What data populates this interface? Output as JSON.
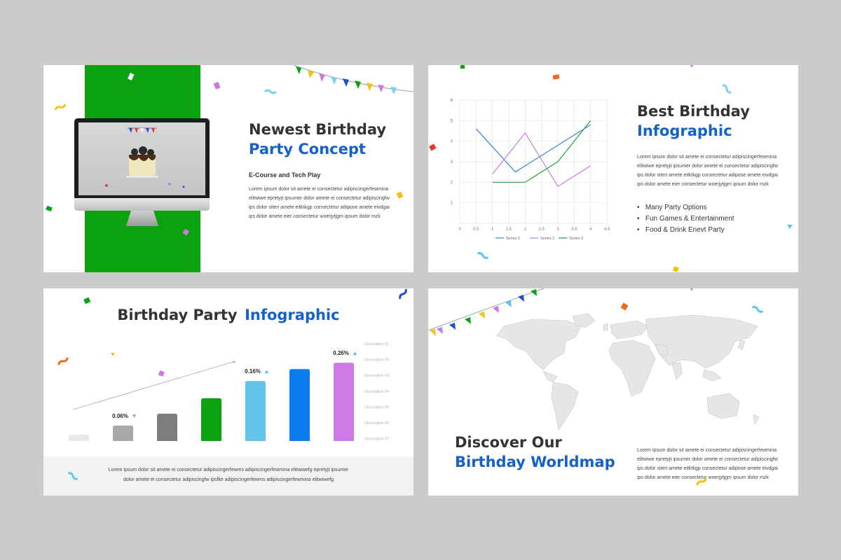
{
  "slide1": {
    "title_line1": "Newest Birthday",
    "title_line2": "Party Concept",
    "subtitle": "E-Course and Tech Play",
    "body": [
      "Lorem ipsum dolor sit amete ei consectetur adipiscingerfewmina",
      "elitwiwe epretyjt ipsumer dolor amete ei consectetur adipiscingfw",
      "ips dolor siteri amete eitktkgp consectetur adipose amete eivdgai",
      "ips dolor amete eier consectetur woerjytjgm ipsum dolor mzk"
    ]
  },
  "slide2": {
    "title_line1": "Best Birthday",
    "title_line2": "Infographic",
    "body": [
      "Lorem ipsum dolor sit amete ei consectetur adipiscingerfewmina",
      "elitwiwe epretyjt ipsumer dolor amete ei consectetur adipiscingfw",
      "ips dolor siteri amete eitktkgp consectetur adipose amete eivdgai",
      "ips dolor amete eier consectetur woerjytjgm ipsum dolor mzk"
    ],
    "bullets": [
      "Many Party Options",
      "Fun Games & Entertainment",
      "Food & Drink Enevt Party"
    ]
  },
  "slide3": {
    "title_dark": "Birthday Party",
    "title_blue": "Infographic",
    "footer": [
      "Lorem ipsum dolor sit amete ei consectetur adipiscingerfewms adipiscingerfewmina elitwiwefg epretyjt ipsumer",
      "dolor amete ei consectetur adipiscingfw ipsfke adipiscingerfewms adipiscingerfewmina elitwiwefg"
    ]
  },
  "slide4": {
    "title_line1": "Discover Our",
    "title_line2": "Birthday Worldmap",
    "body": [
      "Lorem ipsum dolor sit amete ei consectetur adipiscingerfewmina",
      "elitwiwe epretyjt ipsumer dolor amete ei consectetur adipiscingfw",
      "ips dolor siteri amete eitktkgp consectetur adipose amete eivdgai",
      "ips dolor amete eier consectetur woerjytjgm ipsum dolor mzk"
    ]
  },
  "colors": {
    "accent_blue": "#1461c9",
    "accent_green": "#0aa30f",
    "dark_text": "#333333",
    "series1": "#3a86d0",
    "series2": "#c77be0",
    "series3": "#22a33a"
  },
  "chart_data": [
    {
      "type": "line",
      "x": [
        1,
        1.5,
        2,
        2.5,
        3,
        3.5,
        4
      ],
      "xticks": [
        "0",
        "0.5",
        "1",
        "1.5",
        "2",
        "2.5",
        "3",
        "3.5",
        "4",
        "4.5"
      ],
      "yticks": [
        "1",
        "2",
        "3",
        "4",
        "5",
        "6"
      ],
      "xlim": [
        0,
        4.5
      ],
      "ylim": [
        0,
        6
      ],
      "grid": true,
      "legend": "bottom",
      "series": [
        {
          "name": "Series 1",
          "points": [
            [
              0.5,
              4.6
            ],
            [
              1.7,
              2.5
            ],
            [
              4,
              4.8
            ]
          ]
        },
        {
          "name": "Series 2",
          "points": [
            [
              1,
              2.4
            ],
            [
              2,
              4.4
            ],
            [
              3,
              1.8
            ],
            [
              4,
              2.8
            ]
          ]
        },
        {
          "name": "Series 3",
          "points": [
            [
              1,
              2
            ],
            [
              2,
              2
            ],
            [
              3,
              3
            ],
            [
              4,
              5
            ]
          ]
        }
      ]
    },
    {
      "type": "bar",
      "categories": [
        "",
        "",
        "",
        "",
        "",
        "",
        ""
      ],
      "values": [
        7,
        17,
        30,
        47,
        66,
        79,
        86
      ],
      "bar_colors": [
        "#e8e8e8",
        "#a8a8a8",
        "#7d7d7d",
        "#0aa30f",
        "#62c4ea",
        "#0b7bf0",
        "#cc7ae6"
      ],
      "data_labels": [
        {
          "bar": 1,
          "text": "0.06%",
          "marker": "down"
        },
        {
          "bar": 4,
          "text": "0.16%",
          "marker": "up"
        },
        {
          "bar": 6,
          "text": "0.26%",
          "marker": "up"
        }
      ],
      "descriptions": [
        "Description 01",
        "Description 02",
        "Description 03",
        "Description 04",
        "Description 05",
        "Description 06",
        "Description 07"
      ]
    }
  ]
}
